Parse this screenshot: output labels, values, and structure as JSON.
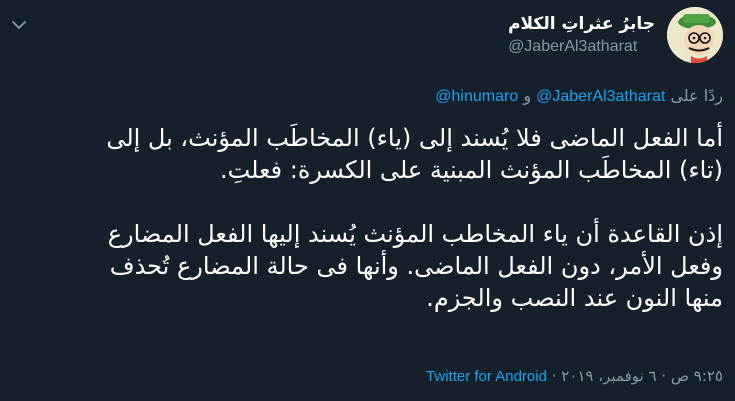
{
  "author": {
    "display_name": "جابرُ عثراتِ الكلام",
    "handle": "@JaberAl3atharat"
  },
  "reply": {
    "prefix": "ردًا على",
    "mention_1": "@JaberAl3atharat",
    "conjunction": "و",
    "mention_2": "@hinumaro"
  },
  "body": {
    "line_1": "أما الفعل الماضى فلا يُسند إلى (ياء) المخاطَب المؤنث، بل إلى",
    "line_2": "(تاء) المخاطَب المؤنث المبنية على الكسرة: فعلتِ.",
    "line_3": "إذن القاعدة أن ياء المخاطب المؤنث يُسند إليها الفعل المضارع",
    "line_4": "وفعل الأمر، دون الفعل الماضى. وأنها فى حالة المضارع تُحذف",
    "line_5": "منها النون عند النصب والجزم."
  },
  "meta": {
    "time": "٩:٢٥ ص",
    "separator": "·",
    "date": "٦ نوفمبر، ٢٠١٩",
    "separator_2": "·",
    "source": "Twitter for Android"
  },
  "icons": {
    "chevron": "chevron-down-icon",
    "avatar": "avatar"
  },
  "colors": {
    "background": "#15202b",
    "text": "#ffffff",
    "secondary": "#8899a6",
    "link": "#1da1f2"
  }
}
